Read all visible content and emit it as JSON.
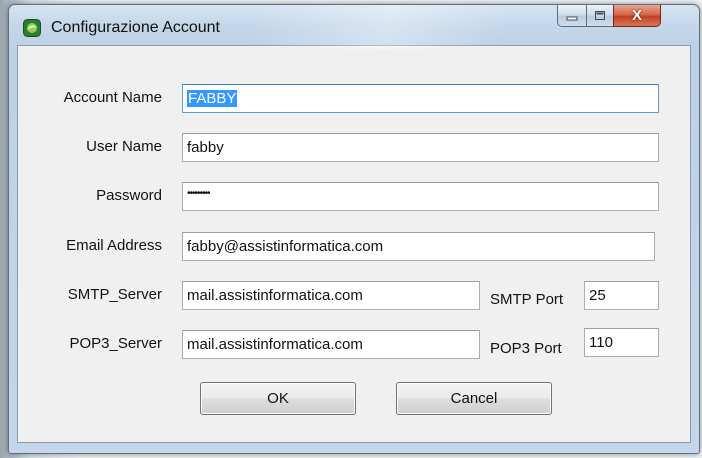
{
  "window": {
    "title": "Configurazione Account",
    "close_glyph": "X"
  },
  "form": {
    "account_name": {
      "label": "Account Name",
      "value": "FABBY"
    },
    "user_name": {
      "label": "User Name",
      "value": "fabby"
    },
    "password": {
      "label": "Password",
      "value": "•••••••••"
    },
    "email_address": {
      "label": "Email Address",
      "value": "fabby@assistinformatica.com"
    },
    "smtp_server": {
      "label": "SMTP_Server",
      "value": "mail.assistinformatica.com"
    },
    "smtp_port": {
      "label": "SMTP Port",
      "value": "25"
    },
    "pop3_server": {
      "label": "POP3_Server",
      "value": "mail.assistinformatica.com"
    },
    "pop3_port": {
      "label": "POP3 Port",
      "value": "110"
    }
  },
  "buttons": {
    "ok_label": "OK",
    "cancel_label": "Cancel"
  },
  "icons": {
    "app": "app-icon",
    "minimize": "minimize-icon",
    "maximize": "maximize-icon",
    "close": "close-icon"
  },
  "colors": {
    "selection": "#3399ff",
    "close_button": "#c1401f",
    "dialog_background": "#f0f0f0"
  }
}
